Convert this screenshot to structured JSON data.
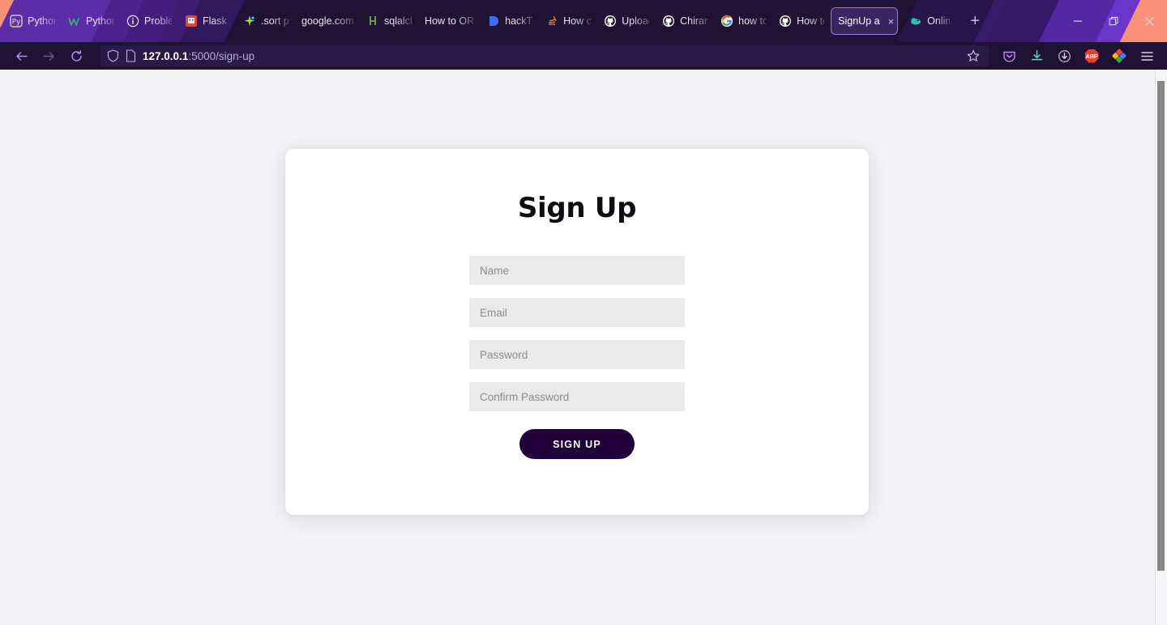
{
  "browser": {
    "tabs": [
      {
        "label": "Python",
        "icon": "python-logo-icon"
      },
      {
        "label": "Python",
        "icon": "w3schools-icon"
      },
      {
        "label": "Problem",
        "icon": "info-circle-icon"
      },
      {
        "label": "Flask Tu",
        "icon": "flask-tutorial-icon"
      },
      {
        "label": ".sort py",
        "icon": "sparkle-icon"
      },
      {
        "label": "google.com",
        "icon": "blank-page-icon"
      },
      {
        "label": "sqlalche",
        "icon": "sqlalchemy-icon"
      },
      {
        "label": "How to OR",
        "icon": "blank-page-icon"
      },
      {
        "label": "hackTU",
        "icon": "hacktu-icon"
      },
      {
        "label": "How ca",
        "icon": "stackoverflow-icon"
      },
      {
        "label": "Upload",
        "icon": "github-icon"
      },
      {
        "label": "Chiranj",
        "icon": "github-icon"
      },
      {
        "label": "how to",
        "icon": "google-icon"
      },
      {
        "label": "How to",
        "icon": "github-icon"
      }
    ],
    "active_tab": {
      "label": "SignUp a",
      "icon": "blank-page-icon",
      "close_label": "×"
    },
    "online_tab": {
      "label": "Online",
      "icon": "teal-cloud-icon"
    },
    "new_tab_label": "+",
    "window_controls": {
      "minimize": "—",
      "maximize": "maximize-icon",
      "close": "✕"
    },
    "nav": {
      "back": "back-arrow-icon",
      "forward": "forward-arrow-icon",
      "reload": "reload-icon"
    },
    "url": {
      "shield": "shield-icon",
      "page": "page-icon",
      "host": "127.0.0.1",
      "path": ":5000/sign-up",
      "bookmark": "star-icon"
    },
    "toolbar_icons": [
      {
        "name": "pocket-icon",
        "color": "#c08ae8"
      },
      {
        "name": "downloads-icon",
        "color": "#4fd6c0"
      },
      {
        "name": "update-circle-icon",
        "color": "#d7cfe8"
      },
      {
        "name": "adblock-plus-icon",
        "label": "ABP",
        "color": "#e8402a"
      },
      {
        "name": "extension-diamond-icon",
        "color": "#4caf50"
      },
      {
        "name": "app-menu-icon",
        "color": "#d7cfe8"
      }
    ],
    "theme_colors": {
      "chrome_bg": "#1f1235",
      "accent_purple": "#6b35c9",
      "accent_salmon": "#f8907a",
      "urlbar_bg": "#2a1a47"
    }
  },
  "page": {
    "background": "#f4f4f6",
    "card": {
      "title": "Sign Up",
      "fields": [
        {
          "name": "name",
          "placeholder": "Name",
          "value": "",
          "type": "text"
        },
        {
          "name": "email",
          "placeholder": "Email",
          "value": "",
          "type": "text"
        },
        {
          "name": "password",
          "placeholder": "Password",
          "value": "",
          "type": "text"
        },
        {
          "name": "confirm_password",
          "placeholder": "Confirm Password",
          "value": "",
          "type": "text"
        }
      ],
      "submit_label": "SIGN UP",
      "submit_color": "#1f0038"
    }
  }
}
